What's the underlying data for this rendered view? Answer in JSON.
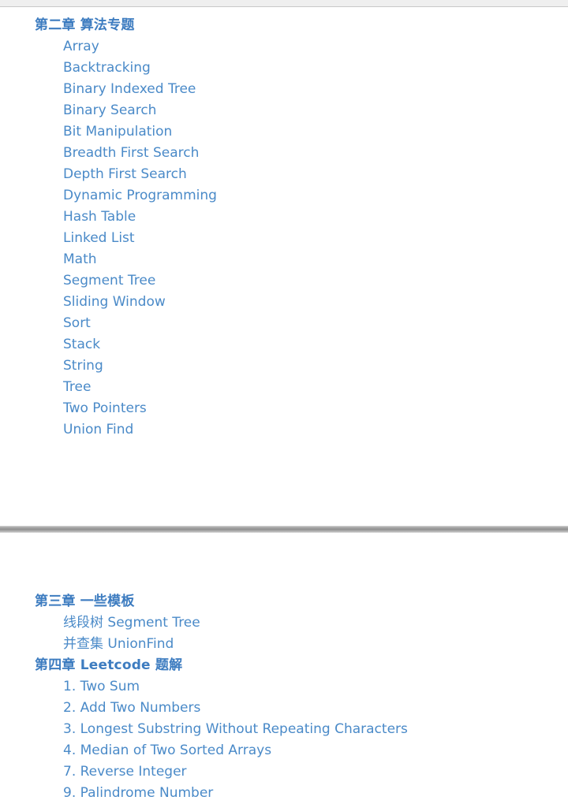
{
  "document": {
    "type": "table-of-contents",
    "link_color": "#4a8ac8",
    "heading_color": "#3d7cc0",
    "background_color": "#ffffff",
    "chrome_bar_color": "#efefef",
    "separator_color": "#8e8e8e"
  },
  "page_one": {
    "groups": [
      {
        "heading": "第二章 算法专题",
        "entries": [
          "Array",
          "Backtracking",
          "Binary Indexed Tree",
          "Binary Search",
          "Bit Manipulation",
          "Breadth First Search",
          "Depth First Search",
          "Dynamic Programming",
          "Hash Table",
          "Linked List",
          "Math",
          "Segment Tree",
          "Sliding Window",
          "Sort",
          "Stack",
          "String",
          "Tree",
          "Two Pointers",
          "Union Find"
        ]
      }
    ]
  },
  "page_two": {
    "groups": [
      {
        "heading": "第三章 一些模板",
        "entries": [
          "线段树 Segment Tree",
          "并查集 UnionFind"
        ]
      },
      {
        "heading": "第四章 Leetcode 题解",
        "entries": [
          "1. Two Sum",
          "2. Add Two Numbers",
          "3. Longest Substring Without Repeating Characters",
          "4. Median of Two Sorted Arrays",
          "7. Reverse Integer",
          "9. Palindrome Number"
        ]
      }
    ]
  }
}
